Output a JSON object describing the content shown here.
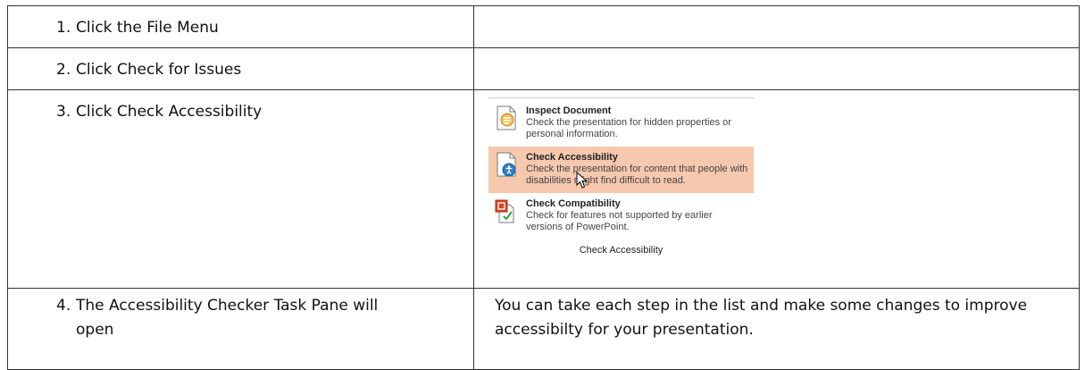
{
  "steps": [
    {
      "number": "1.",
      "text": "Click the File Menu"
    },
    {
      "number": "2.",
      "text": "Click Check for Issues"
    },
    {
      "number": "3.",
      "text": "Click Check Accessibility"
    },
    {
      "number": "4.",
      "text": "The Accessibility Checker Task Pane will open"
    }
  ],
  "notes": {
    "step4": "You can take each step in the list and make some changes to improve accessibilty for your presentation."
  },
  "menu": {
    "items": [
      {
        "title": "Inspect Document",
        "desc": "Check the presentation for hidden properties or personal information.",
        "icon": "inspect-document-icon",
        "highlighted": false
      },
      {
        "title": "Check Accessibility",
        "desc": "Check the presentation for content that people with disabilities might find difficult to read.",
        "icon": "check-accessibility-icon",
        "highlighted": true
      },
      {
        "title": "Check Compatibility",
        "desc": "Check for features not supported by earlier versions of PowerPoint.",
        "icon": "check-compatibility-icon",
        "highlighted": false
      }
    ],
    "caption": "Check Accessibility",
    "highlight_color": "#f6c8ae",
    "cursor_icon": "mouse-pointer-icon"
  }
}
